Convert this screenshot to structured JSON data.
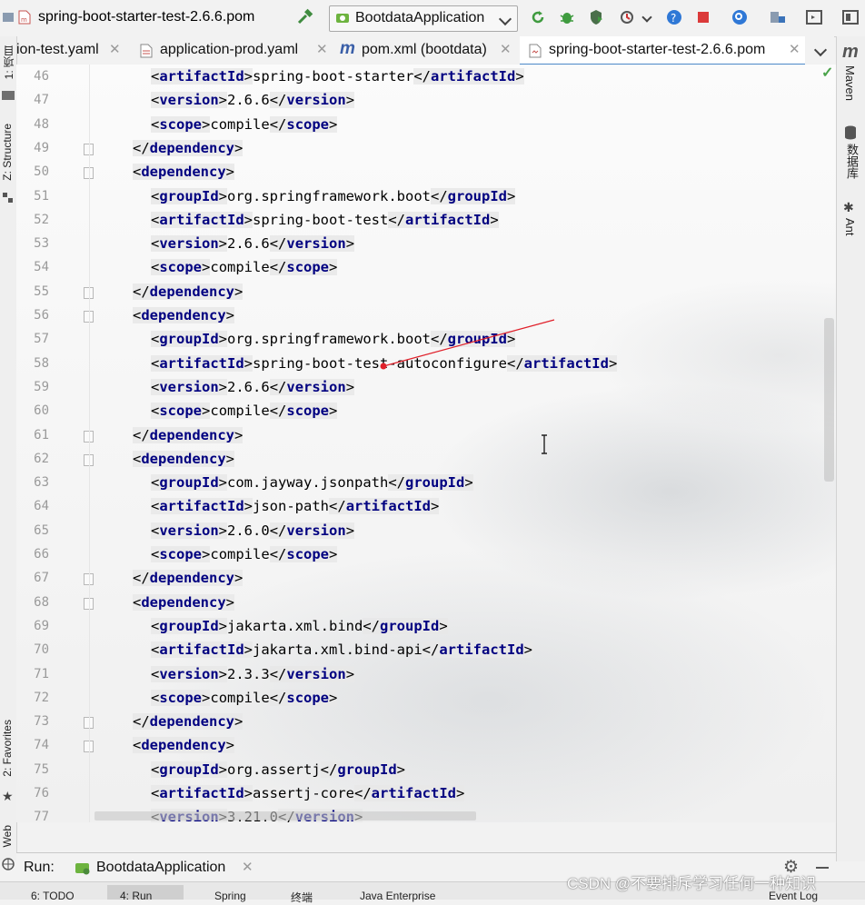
{
  "toolbar": {
    "breadcrumb_file": "spring-boot-starter-test-2.6.6.pom",
    "run_config": "BootdataApplication"
  },
  "tabs": [
    {
      "label": "ion-test.yaml",
      "active": false
    },
    {
      "label": "application-prod.yaml",
      "active": false
    },
    {
      "label": "pom.xml (bootdata)",
      "active": false
    },
    {
      "label": "spring-boot-starter-test-2.6.6.pom",
      "active": true
    }
  ],
  "left_tools": {
    "project": "1: 项目",
    "structure": "Z: Structure",
    "favorites": "2: Favorites",
    "web": "Web"
  },
  "right_tools": {
    "maven": "Maven",
    "database": "数据库",
    "ant": "Ant"
  },
  "editor": {
    "lines": [
      {
        "n": "46",
        "indent": 2,
        "tag": "artifactId",
        "text": "spring-boot-starter"
      },
      {
        "n": "47",
        "indent": 2,
        "tag": "version",
        "text": "2.6.6"
      },
      {
        "n": "48",
        "indent": 2,
        "tag": "scope",
        "text": "compile"
      },
      {
        "n": "49",
        "indent": 1,
        "close": "dependency",
        "fold": true
      },
      {
        "n": "50",
        "indent": 1,
        "open": "dependency",
        "fold": true
      },
      {
        "n": "51",
        "indent": 2,
        "tag": "groupId",
        "text": "org.springframework.boot"
      },
      {
        "n": "52",
        "indent": 2,
        "tag": "artifactId",
        "text": "spring-boot-test"
      },
      {
        "n": "53",
        "indent": 2,
        "tag": "version",
        "text": "2.6.6"
      },
      {
        "n": "54",
        "indent": 2,
        "tag": "scope",
        "text": "compile"
      },
      {
        "n": "55",
        "indent": 1,
        "close": "dependency",
        "fold": true
      },
      {
        "n": "56",
        "indent": 1,
        "open": "dependency",
        "fold": true
      },
      {
        "n": "57",
        "indent": 2,
        "tag": "groupId",
        "text": "org.springframework.boot"
      },
      {
        "n": "58",
        "indent": 2,
        "tag": "artifactId",
        "text": "spring-boot-test-autoconfigure"
      },
      {
        "n": "59",
        "indent": 2,
        "tag": "version",
        "text": "2.6.6"
      },
      {
        "n": "60",
        "indent": 2,
        "tag": "scope",
        "text": "compile"
      },
      {
        "n": "61",
        "indent": 1,
        "close": "dependency",
        "fold": true
      },
      {
        "n": "62",
        "indent": 1,
        "open": "dependency",
        "fold": true
      },
      {
        "n": "63",
        "indent": 2,
        "tag": "groupId",
        "text": "com.jayway.jsonpath"
      },
      {
        "n": "64",
        "indent": 2,
        "tag": "artifactId",
        "text": "json-path"
      },
      {
        "n": "65",
        "indent": 2,
        "tag": "version",
        "text": "2.6.0"
      },
      {
        "n": "66",
        "indent": 2,
        "tag": "scope",
        "text": "compile"
      },
      {
        "n": "67",
        "indent": 1,
        "close": "dependency",
        "fold": true
      },
      {
        "n": "68",
        "indent": 1,
        "open": "dependency",
        "fold": true
      },
      {
        "n": "69",
        "indent": 2,
        "tag": "groupId",
        "text": "jakarta.xml.bind"
      },
      {
        "n": "70",
        "indent": 2,
        "tag": "artifactId",
        "text": "jakarta.xml.bind-api"
      },
      {
        "n": "71",
        "indent": 2,
        "tag": "version",
        "text": "2.3.3"
      },
      {
        "n": "72",
        "indent": 2,
        "tag": "scope",
        "text": "compile"
      },
      {
        "n": "73",
        "indent": 1,
        "close": "dependency",
        "fold": true
      },
      {
        "n": "74",
        "indent": 1,
        "open": "dependency",
        "fold": true
      },
      {
        "n": "75",
        "indent": 2,
        "tag": "groupId",
        "text": "org.assertj"
      },
      {
        "n": "76",
        "indent": 2,
        "tag": "artifactId",
        "text": "assertj-core"
      },
      {
        "n": "77",
        "indent": 2,
        "tag": "version",
        "text": "3.21.0"
      }
    ]
  },
  "run_panel": {
    "label": "Run:",
    "tab": "BootdataApplication"
  },
  "bottom_tools": [
    "6: TODO",
    "4: Run",
    "Spring",
    "终端",
    "Java Enterprise",
    "Event Log"
  ],
  "watermark": "CSDN @不要排斥学习任何一种知识",
  "colors": {
    "tag": "#000080",
    "active_tab_underline": "#4b88c8",
    "annotation": "#e0202a"
  }
}
